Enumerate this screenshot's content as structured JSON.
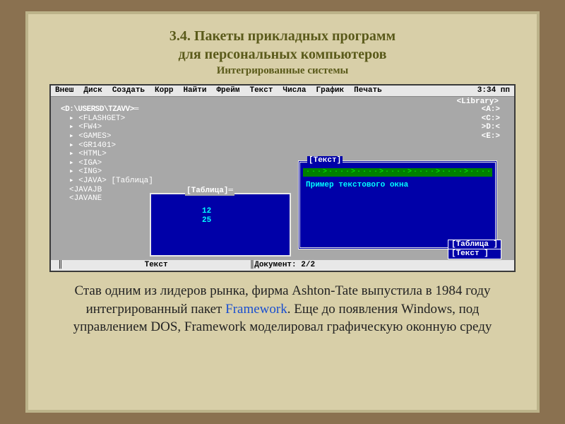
{
  "title": {
    "line1": "3.4. Пакеты прикладных программ",
    "line2": "для персональных компьютеров",
    "sub": "Интегрированные системы"
  },
  "menu": {
    "items": [
      "Внеш",
      "Диск",
      "Создать",
      "Корр",
      "Найти",
      "Фрейм",
      "Текст",
      "Числа",
      "График",
      "Печать"
    ],
    "time": "3:34 пп"
  },
  "library_label": "<Library>",
  "path": "<D:\\USERSD\\TZAVV>═",
  "files": [
    "<FLASHGET>",
    "<FW4>",
    "<GAMES>",
    "<GR1401>",
    "<HTML>",
    "<IGA>",
    "<ING>",
    "<JAVA> [Таблица]",
    "<JAVAJB",
    "<JAVANE"
  ],
  "drives": [
    "<A:>",
    "<C:>",
    ">D:<",
    "<E:>"
  ],
  "table_window": {
    "label": "[Таблица]═",
    "val1": "12",
    "val2": "25"
  },
  "text_window": {
    "label": "[Текст]",
    "dots": "···>····>····>····>····>····>····>····>···",
    "body": "Пример текстового окна"
  },
  "stack": {
    "a": "[Таблица ]",
    "b": "[Текст   ]"
  },
  "status": {
    "left": "║",
    "center": "Текст",
    "right": "║Документ: 2/2"
  },
  "paragraph": {
    "p1a": "Став одним из лидеров рынка, фирма Ashton-Tate выпустила в  1984 году  интегрированный пакет ",
    "link": "Framework",
    "p1b": ". Еще до появления Windows, под управлением DOS,  Framework моделировал графическую оконную среду"
  }
}
